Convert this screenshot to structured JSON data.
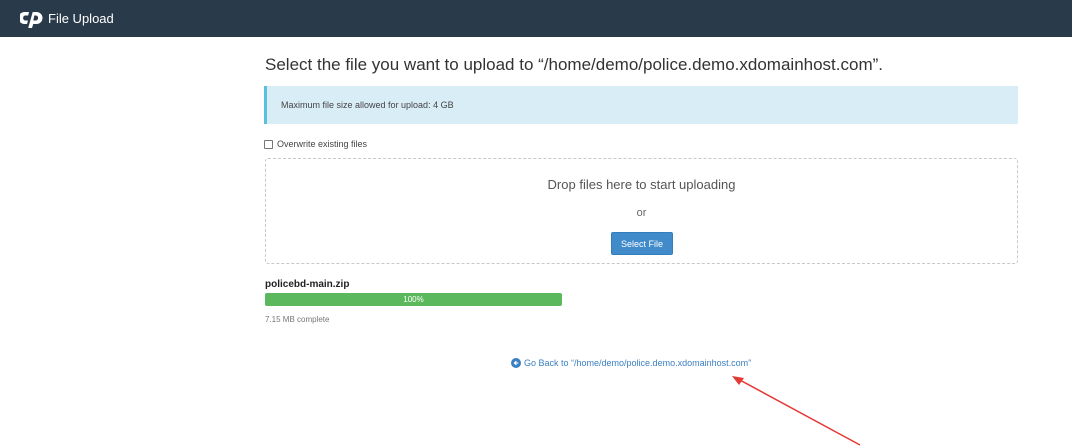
{
  "header": {
    "logo_icon": "cpanel-logo-icon",
    "title": "File Upload"
  },
  "main": {
    "title": "Select the file you want to upload to “/home/demo/police.demo.xdomainhost.com”.",
    "alert": "Maximum file size allowed for upload: 4 GB",
    "overwrite_label": "Overwrite existing files",
    "overwrite_checked": false,
    "dropzone": {
      "text": "Drop files here to start uploading",
      "or": "or",
      "button_label": "Select File"
    },
    "upload": {
      "file_name": "policebd-main.zip",
      "progress_percent": 100,
      "progress_label": "100%",
      "status": "7.15 MB complete"
    },
    "go_back": {
      "icon": "circle-arrow-left-icon",
      "label": "Go Back to “/home/demo/police.demo.xdomainhost.com”"
    }
  },
  "annotation": {
    "icon": "red-arrow-annotation",
    "color": "#e53935"
  },
  "colors": {
    "header_bg": "#293a4a",
    "alert_bg": "#d9edf7",
    "alert_border": "#5bc0de",
    "primary": "#428bca",
    "progress": "#5cb85c",
    "link": "#3a7fc1"
  }
}
